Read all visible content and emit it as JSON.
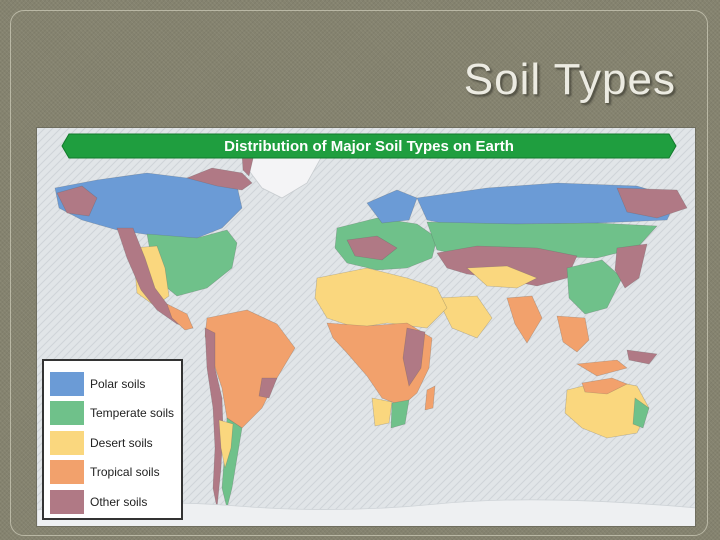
{
  "slide": {
    "title": "Soil Types"
  },
  "map": {
    "title": "Distribution of Major Soil Types on Earth",
    "banner_color": "#1f9e3f",
    "ocean_color": "#dfe3e6",
    "legend": [
      {
        "label": "Polar soils",
        "color": "#6b9bd6"
      },
      {
        "label": "Temperate soils",
        "color": "#6fc18a"
      },
      {
        "label": "Desert soils",
        "color": "#fad77e"
      },
      {
        "label": "Tropical soils",
        "color": "#f2a16c"
      },
      {
        "label": "Other soils",
        "color": "#b07985"
      }
    ]
  }
}
